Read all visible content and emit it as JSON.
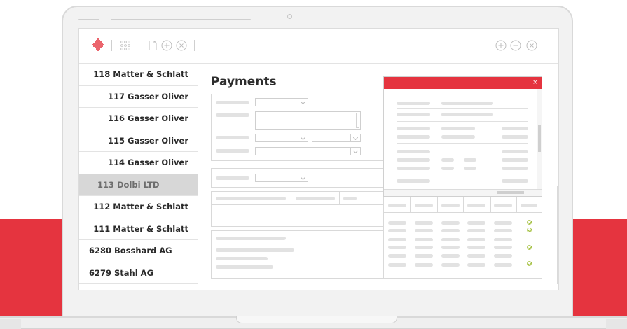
{
  "sidebar": {
    "items": [
      {
        "label": "118 Matter & Schlatt",
        "active": false
      },
      {
        "label": "117 Gasser Oliver",
        "active": false
      },
      {
        "label": "116 Gasser Oliver",
        "active": false
      },
      {
        "label": "115 Gasser Oliver",
        "active": false
      },
      {
        "label": "114 Gasser Oliver",
        "active": false
      },
      {
        "label": "113 Dolbi LTD",
        "active": true
      },
      {
        "label": "112 Matter & Schlatt",
        "active": false
      },
      {
        "label": "111 Matter & Schlatt",
        "active": false
      },
      {
        "label": "6280 Bosshard AG",
        "active": false
      },
      {
        "label": "6279 Stahl AG",
        "active": false
      }
    ]
  },
  "main": {
    "title": "Payments"
  },
  "dialog": {
    "close_glyph": "×"
  },
  "toolbar": {
    "left_icons": [
      "logo-icon",
      "grid-icon",
      "document-icon",
      "add-circle-icon",
      "close-circle-icon"
    ],
    "right_icons": [
      "add-circle-icon",
      "remove-circle-icon",
      "close-circle-icon"
    ]
  },
  "colors": {
    "accent": "#e5343f",
    "check": "#9dbb3a",
    "placeholder": "#e2e2e2"
  }
}
